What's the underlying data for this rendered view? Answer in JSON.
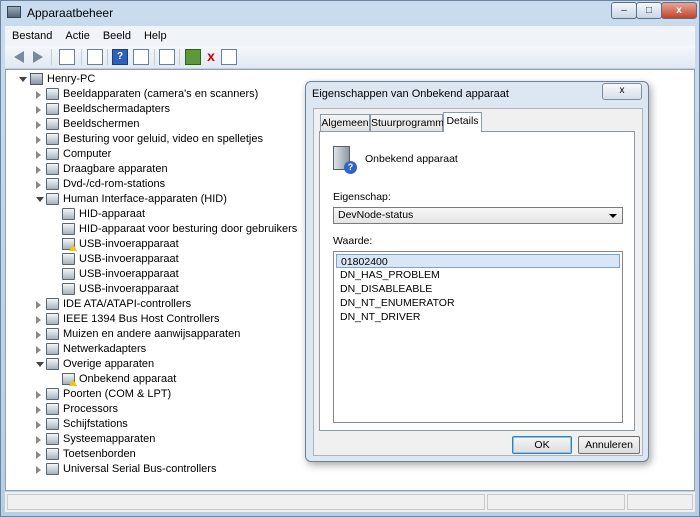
{
  "window": {
    "title": "Apparaatbeheer",
    "controls": {
      "minimize": "–",
      "maximize": "□",
      "close": "x"
    }
  },
  "menu": [
    "Bestand",
    "Actie",
    "Beeld",
    "Help"
  ],
  "toolbar": {
    "icons": [
      "back-arrow-icon",
      "forward-arrow-icon",
      "show-hide-console-tree-icon",
      "properties-icon",
      "help-icon",
      "refresh-view-icon",
      "update-driver-icon",
      "uninstall-icon",
      "scan-hardware-icon"
    ]
  },
  "tree": {
    "root": "Henry-PC",
    "items": [
      {
        "label": "Beeldapparaten (camera's en scanners)",
        "level": 1,
        "state": "closed"
      },
      {
        "label": "Beeldschermadapters",
        "level": 1,
        "state": "closed"
      },
      {
        "label": "Beeldschermen",
        "level": 1,
        "state": "closed"
      },
      {
        "label": "Besturing voor geluid, video en spelletjes",
        "level": 1,
        "state": "closed"
      },
      {
        "label": "Computer",
        "level": 1,
        "state": "closed"
      },
      {
        "label": "Draagbare apparaten",
        "level": 1,
        "state": "closed"
      },
      {
        "label": "Dvd-/cd-rom-stations",
        "level": 1,
        "state": "closed"
      },
      {
        "label": "Human Interface-apparaten (HID)",
        "level": 1,
        "state": "open"
      },
      {
        "label": "HID-apparaat",
        "level": 2,
        "state": "none"
      },
      {
        "label": "HID-apparaat voor besturing door gebruikers",
        "level": 2,
        "state": "none"
      },
      {
        "label": "USB-invoerapparaat",
        "level": 2,
        "state": "none",
        "warning": true
      },
      {
        "label": "USB-invoerapparaat",
        "level": 2,
        "state": "none"
      },
      {
        "label": "USB-invoerapparaat",
        "level": 2,
        "state": "none"
      },
      {
        "label": "USB-invoerapparaat",
        "level": 2,
        "state": "none"
      },
      {
        "label": "IDE ATA/ATAPI-controllers",
        "level": 1,
        "state": "closed"
      },
      {
        "label": "IEEE 1394 Bus Host Controllers",
        "level": 1,
        "state": "closed"
      },
      {
        "label": "Muizen en andere aanwijsapparaten",
        "level": 1,
        "state": "closed"
      },
      {
        "label": "Netwerkadapters",
        "level": 1,
        "state": "closed"
      },
      {
        "label": "Overige apparaten",
        "level": 1,
        "state": "open"
      },
      {
        "label": "Onbekend apparaat",
        "level": 2,
        "state": "none",
        "warning": true
      },
      {
        "label": "Poorten (COM & LPT)",
        "level": 1,
        "state": "closed"
      },
      {
        "label": "Processors",
        "level": 1,
        "state": "closed"
      },
      {
        "label": "Schijfstations",
        "level": 1,
        "state": "closed"
      },
      {
        "label": "Systeemapparaten",
        "level": 1,
        "state": "closed"
      },
      {
        "label": "Toetsenborden",
        "level": 1,
        "state": "closed"
      },
      {
        "label": "Universal Serial Bus-controllers",
        "level": 1,
        "state": "closed"
      }
    ]
  },
  "dialog": {
    "title": "Eigenschappen van Onbekend apparaat",
    "close": "x",
    "tabs": [
      "Algemeen",
      "Stuurprogramma",
      "Details"
    ],
    "active_tab": "Details",
    "device_name": "Onbekend apparaat",
    "property_label": "Eigenschap:",
    "property_value": "DevNode-status",
    "value_label": "Waarde:",
    "values": [
      "01802400",
      "DN_HAS_PROBLEM",
      "DN_DISABLEABLE",
      "DN_NT_ENUMERATOR",
      "DN_NT_DRIVER"
    ],
    "selected_value_index": 0,
    "ok": "OK",
    "cancel": "Annuleren"
  },
  "colors": {
    "accent": "#2f66c5",
    "warning": "#f1c40f"
  }
}
